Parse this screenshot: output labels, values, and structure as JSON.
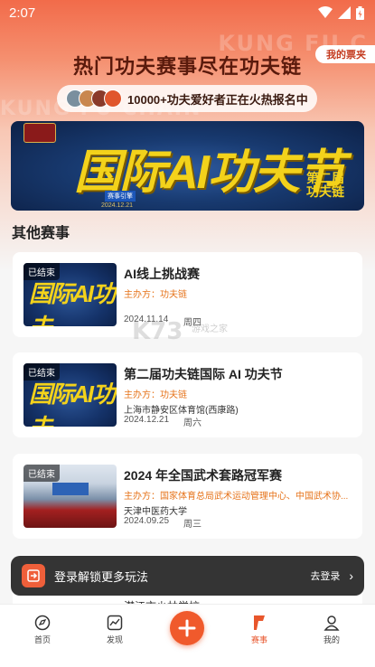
{
  "status_bar": {
    "time": "2:07"
  },
  "header": {
    "watermark": "KUNG FU C",
    "watermark_left": "KUNG FU CHAIN",
    "title": "热门功夫赛事尽在功夫链",
    "ticket_button": "我的票夹",
    "signup_text": "10000+功夫爱好者正在火热报名中"
  },
  "banner": {
    "title": "国际AI功夫节",
    "subtitle_line1": "第二届",
    "subtitle_line2": "功夫链",
    "tag": "赛事引擎",
    "date": "2024.12.21"
  },
  "section": {
    "title": "其他赛事"
  },
  "events": [
    {
      "badge": "已结束",
      "thumb_text": "国际AI功夫",
      "title": "AI线上挑战赛",
      "organizer": "主办方：功夫链",
      "venue": "",
      "date": "2024.11.14",
      "weekday": "周四"
    },
    {
      "badge": "已结束",
      "thumb_text": "国际AI功夫",
      "title": "第二届功夫链国际 AI 功夫节",
      "organizer": "主办方：功夫链",
      "venue": "上海市静安区体育馆(西康路)",
      "date": "2024.12.21",
      "weekday": "周六"
    },
    {
      "badge": "已结束",
      "thumb_text": "",
      "title": "2024 年全国武术套路冠军赛",
      "organizer": "主办方：国家体育总局武术运动管理中心、中国武术协...",
      "venue": "天津中医药大学",
      "date": "2024.09.25",
      "weekday": "周三"
    }
  ],
  "partial_card": {
    "text": "潜江市少林学校"
  },
  "login_bar": {
    "text": "登录解锁更多玩法",
    "link": "去登录"
  },
  "watermark_site": {
    "main": "K73",
    "sub": "游戏之家"
  },
  "tabbar": {
    "items": [
      {
        "label": "首页",
        "icon": "home-icon"
      },
      {
        "label": "发现",
        "icon": "chart-icon"
      },
      {
        "label": "",
        "icon": "plus-icon"
      },
      {
        "label": "赛事",
        "icon": "flag-icon"
      },
      {
        "label": "我的",
        "icon": "user-icon"
      }
    ]
  },
  "colors": {
    "accent": "#f05a2c",
    "organizer": "#e6731a",
    "banner_gold": "#f3d21b"
  }
}
